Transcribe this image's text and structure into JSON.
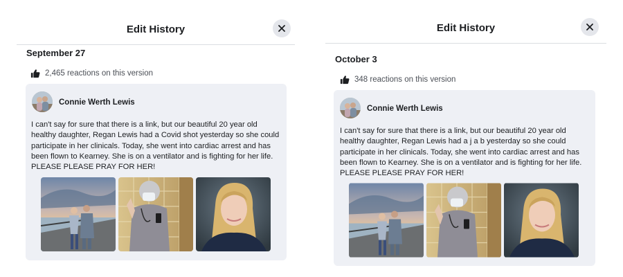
{
  "left_version": {
    "header_title": "Edit History",
    "close_icon": "close-icon",
    "date": "September 27",
    "reactions_text": "2,465 reactions on this version",
    "reaction_icon": "thumbs-up-icon",
    "author": "Connie Werth Lewis",
    "post_text": "I can't say for sure that there is a link, but our beautiful 20 year old\nhealthy daughter, Regan Lewis had a Covid shot yesterday so she could\nparticipate in her clinicals. Today, she went into cardiac arrest and has\nbeen flown to Kearney. She is on a ventilator and is fighting for her life.\nPLEASE PLEASE PRAY FOR HER!",
    "photos": [
      "beach-pier-photo",
      "hospital-mirror-selfie-photo",
      "portrait-photo"
    ]
  },
  "right_version": {
    "header_title": "Edit History",
    "close_icon": "close-icon",
    "date": "October 3",
    "reactions_text": "348 reactions on this version",
    "reaction_icon": "thumbs-up-icon",
    "author": "Connie Werth Lewis",
    "post_text": "I can't say for sure that there is a link, but our beautiful 20 year old\nhealthy daughter, Regan Lewis had a j a b   yesterday so she could\nparticipate in her clinicals. Today, she went into cardiac arrest and has\nbeen flown to Kearney. She is on a ventilator and is fighting for her life.\nPLEASE PLEASE PRAY FOR HER!",
    "photos": [
      "beach-pier-photo",
      "hospital-mirror-selfie-photo",
      "portrait-photo"
    ]
  },
  "colors": {
    "card_bg": "#eef0f5",
    "close_bg": "#e4e6eb",
    "divider": "#dadde1",
    "text": "#1c1e21",
    "muted": "#4b4f56"
  }
}
